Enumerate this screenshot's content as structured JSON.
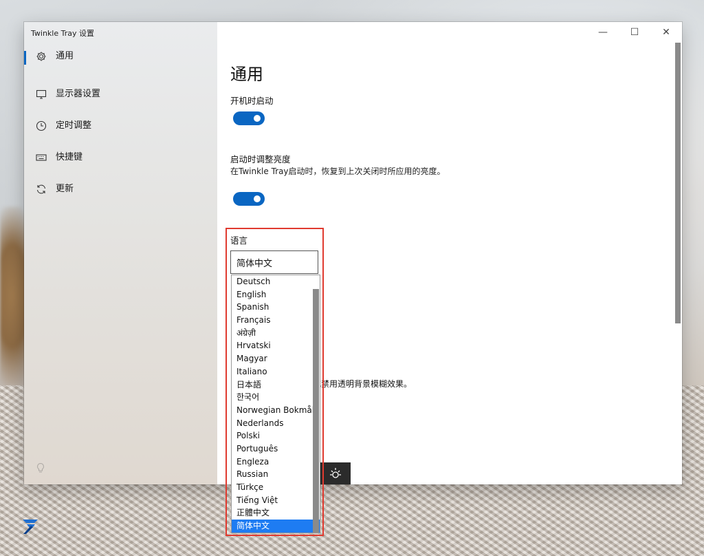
{
  "window": {
    "title": "Twinkle Tray 设置"
  },
  "sidebar": {
    "items": [
      {
        "label": "通用",
        "icon": "gear-icon",
        "selected": true
      },
      {
        "label": "显示器设置",
        "icon": "monitor-icon",
        "selected": false
      },
      {
        "label": "定时调整",
        "icon": "clock-icon",
        "selected": false
      },
      {
        "label": "快捷键",
        "icon": "keyboard-icon",
        "selected": false
      },
      {
        "label": "更新",
        "icon": "refresh-icon",
        "selected": false
      }
    ]
  },
  "titlebar": {
    "minimize": "—",
    "maximize": "☐",
    "close": "✕"
  },
  "page": {
    "title": "通用",
    "startup_label": "开机时启动",
    "startup_enabled": true,
    "adjust_label": "启动时调整亮度",
    "adjust_desc": "在Twinkle Tray启动时，恢复到上次关闭时所应用的亮度。",
    "adjust_enabled": true,
    "language_label": "语言",
    "language_selected": "简体中文",
    "partial_desc": "或禁用透明背景模糊效果。"
  },
  "language_options": [
    "Deutsch",
    "English",
    "Spanish",
    "Français",
    "अंग्रेज़ी",
    "Hrvatski",
    "Magyar",
    "Italiano",
    "日本語",
    "한국어",
    "Norwegian Bokmål",
    "Nederlands",
    "Polski",
    "Português",
    "Engleza",
    "Russian",
    "Türkçe",
    "Tiếng Việt",
    "正體中文",
    "简体中文"
  ],
  "colors": {
    "accent": "#0a66c2",
    "highlight_border": "#e03a2f",
    "selected_option": "#1e7cf2"
  }
}
